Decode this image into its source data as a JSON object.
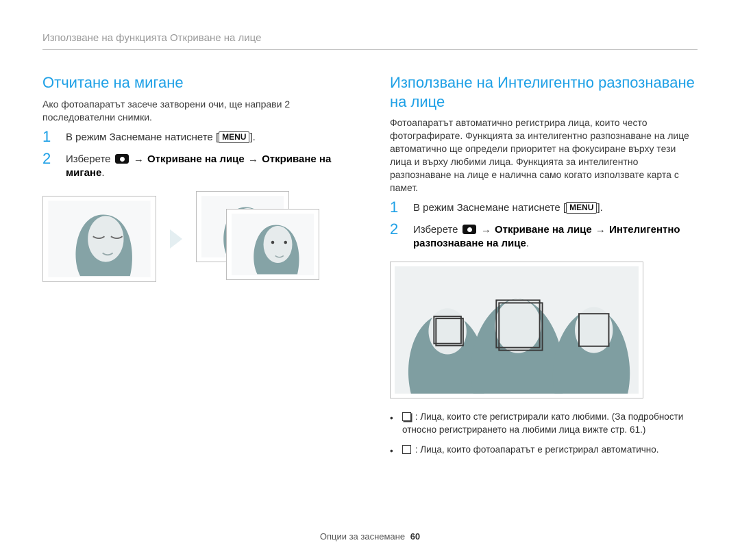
{
  "header": {
    "running_head": "Използване на функцията Откриване на лице"
  },
  "left": {
    "title": "Отчитане на мигане",
    "intro": "Aко фотоапаратът засече затворени очи, ще направи 2 последователни снимки.",
    "steps": [
      {
        "num": "1",
        "pre": "В режим Заснемане натиснете ",
        "menu": "MENU",
        "post": "."
      },
      {
        "num": "2",
        "pre": "Изберете ",
        "bold1": "Откриване на лице",
        "arrow1": "→",
        "bold2": "Откриване на мигане",
        "post": "."
      }
    ]
  },
  "right": {
    "title": "Използване на Интелигентно разпознаване на лице",
    "intro": "Фотоапаратът автоматично регистрира лица, които често фотографирате. Функцията за интелигентно разпознаване на лице автоматично ще определи приоритет на фокусиране върху тези лица и върху любими лица. Функцията за интелигентно разпознаване на лице е налична само когато използвате карта с памет.",
    "steps": [
      {
        "num": "1",
        "pre": "В режим Заснемане натиснете ",
        "menu": "MENU",
        "post": "."
      },
      {
        "num": "2",
        "pre": "Изберете ",
        "bold1": "Откриване на лице",
        "arrow1": "→",
        "bold2": "Интелигентно разпознаване на лице",
        "post": "."
      }
    ],
    "bullets": [
      {
        "icon": "double-square",
        "text": ": Лица, които сте регистрирали като любими. (За подробности относно регистрирането на любими лица вижте стр. 61.)"
      },
      {
        "icon": "single-square",
        "text": ": Лица, които фотоапаратът е регистрирал автоматично."
      }
    ]
  },
  "footer": {
    "section": "Опции за заснемане",
    "page": "60"
  }
}
